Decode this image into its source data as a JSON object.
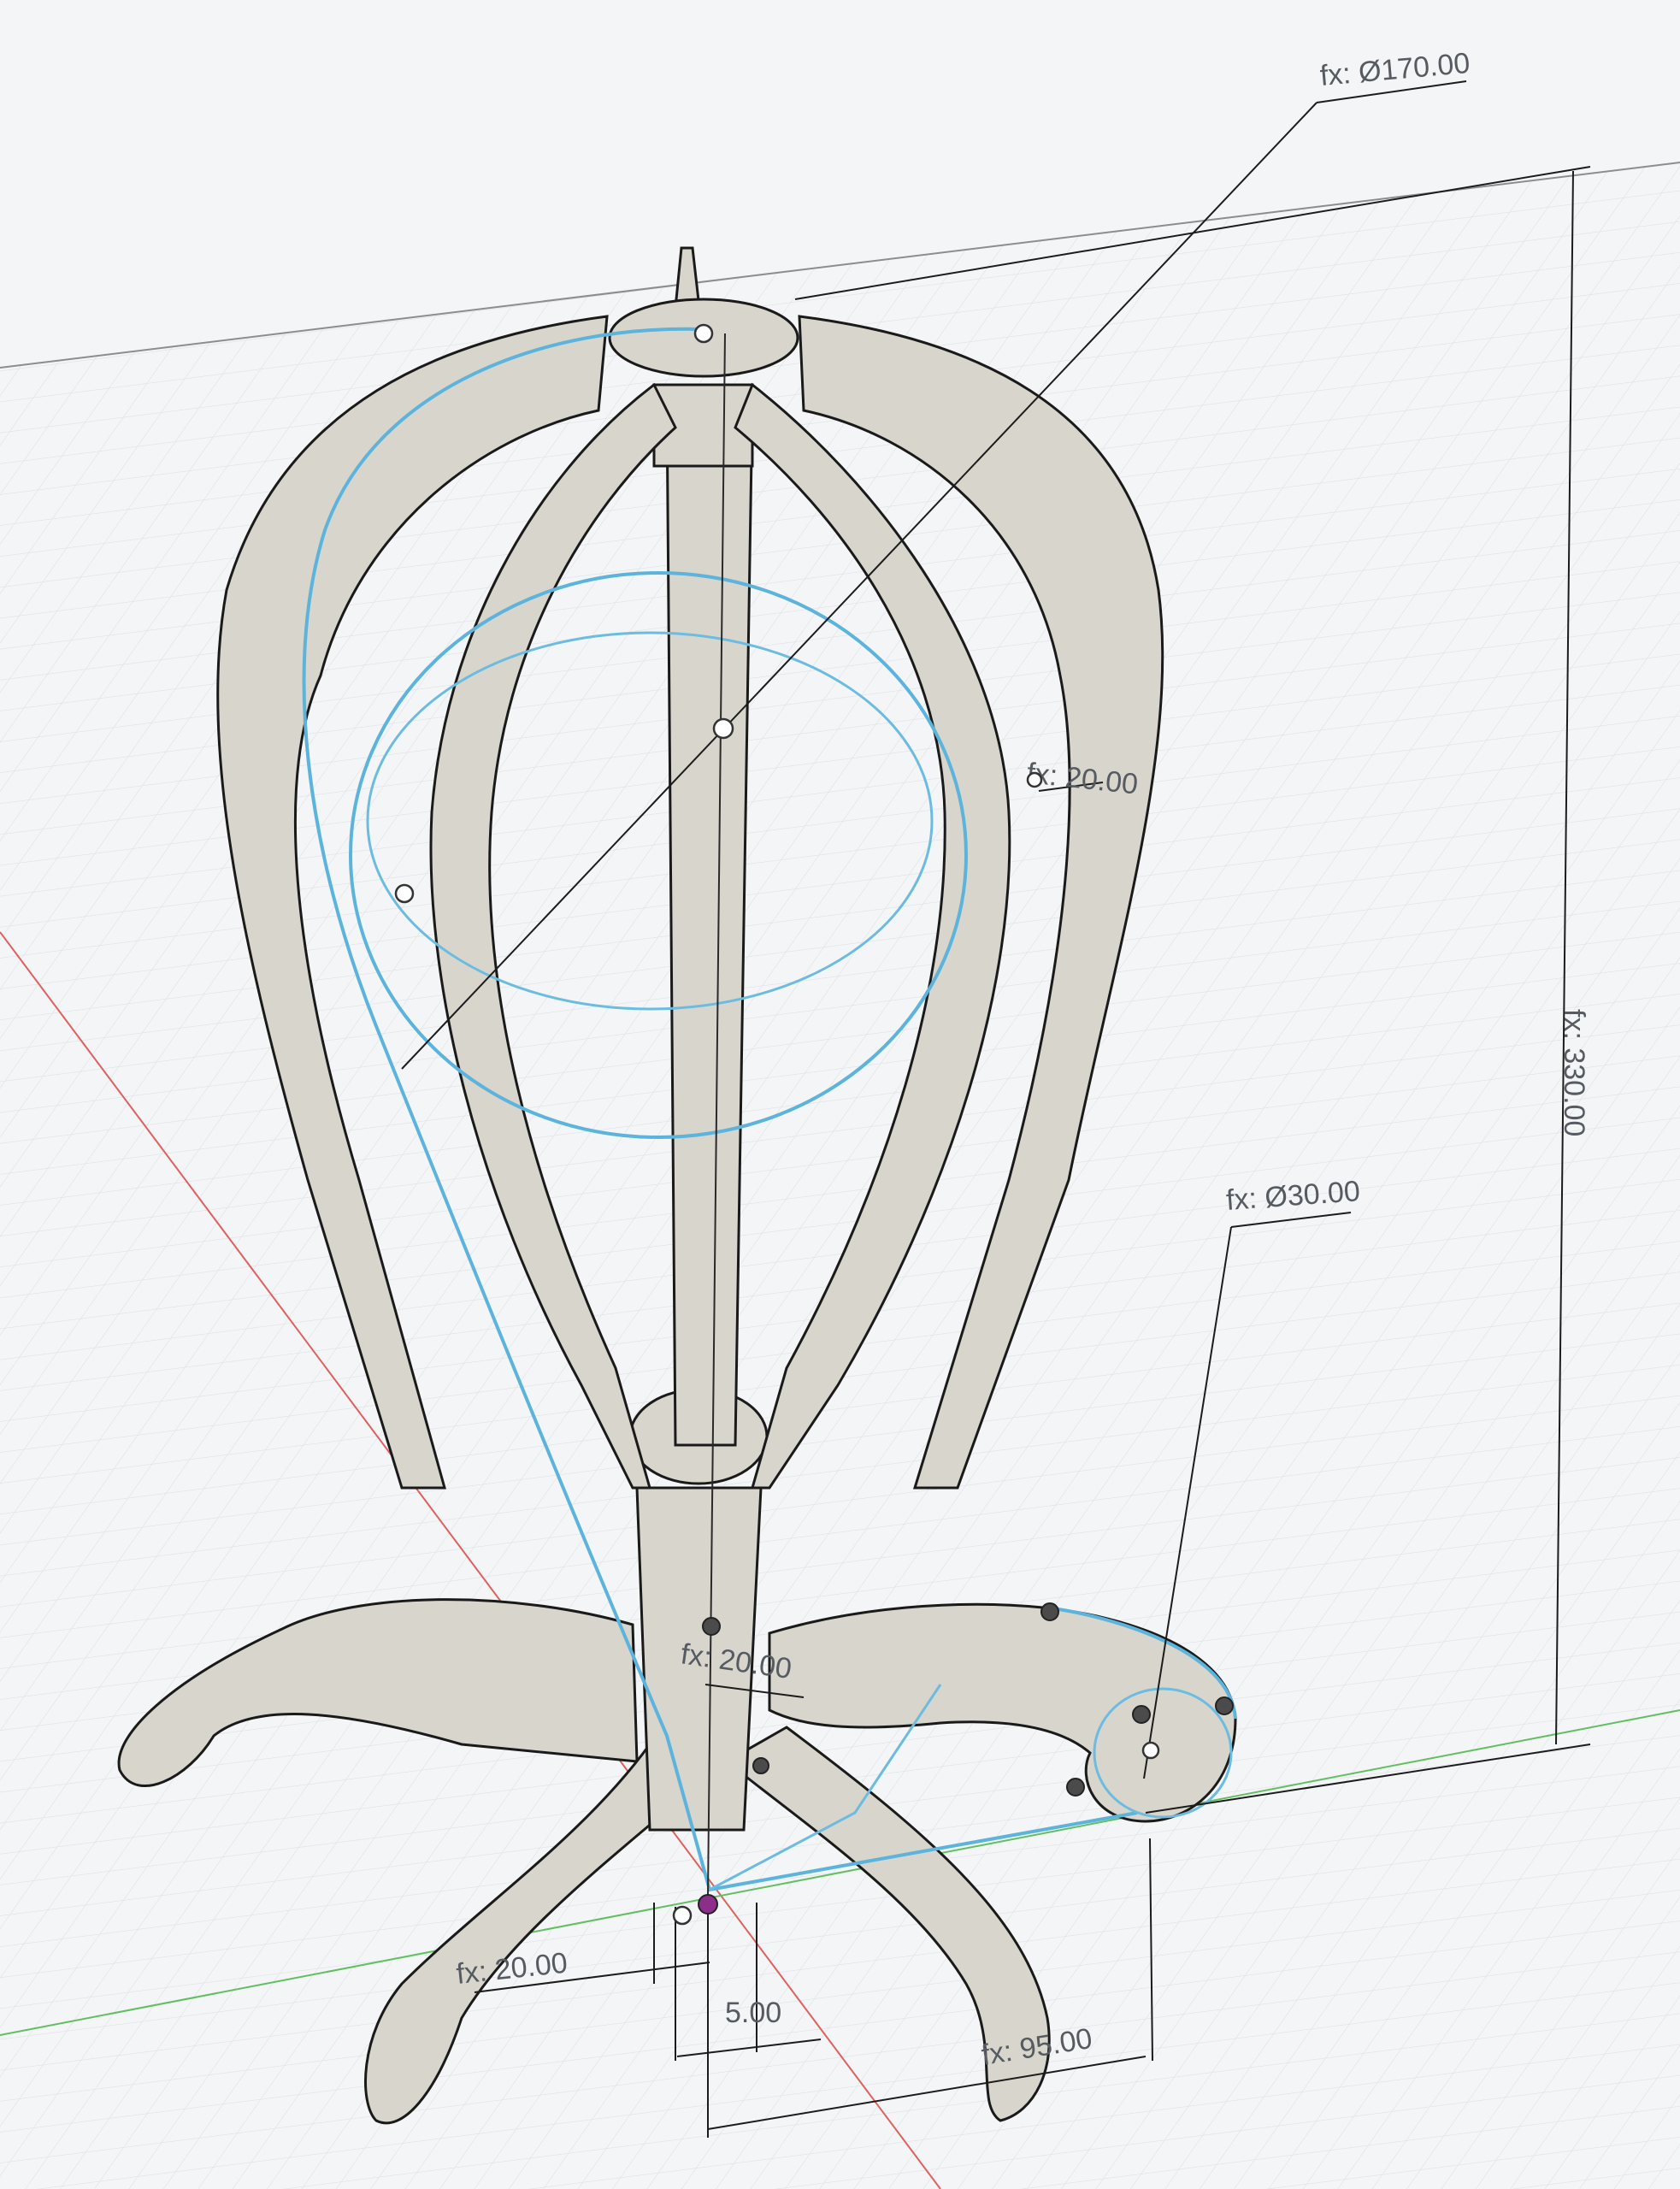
{
  "viewport": {
    "background": "#f4f5f6",
    "grid_color": "#dfe3e7",
    "sketch_color": "#5cb4dc",
    "body_color": "#d8d5cd",
    "profile_fill": "#d3e9f7",
    "x_axis_color": "#e06060",
    "y_axis_color": "#60c060"
  },
  "dimensions": {
    "outer_diameter": "fx: Ø170.00",
    "height": "fx: 330.00",
    "foot_diameter": "fx: Ø30.00",
    "ring_width": "fx: 20.00",
    "stem_width": "fx: 20.00",
    "base_width": "fx: 20.00",
    "offset": "5.00",
    "foot_reach": "fx: 95.00"
  },
  "model": {
    "icon": "wig-stand-model",
    "sketch_points": 11
  }
}
